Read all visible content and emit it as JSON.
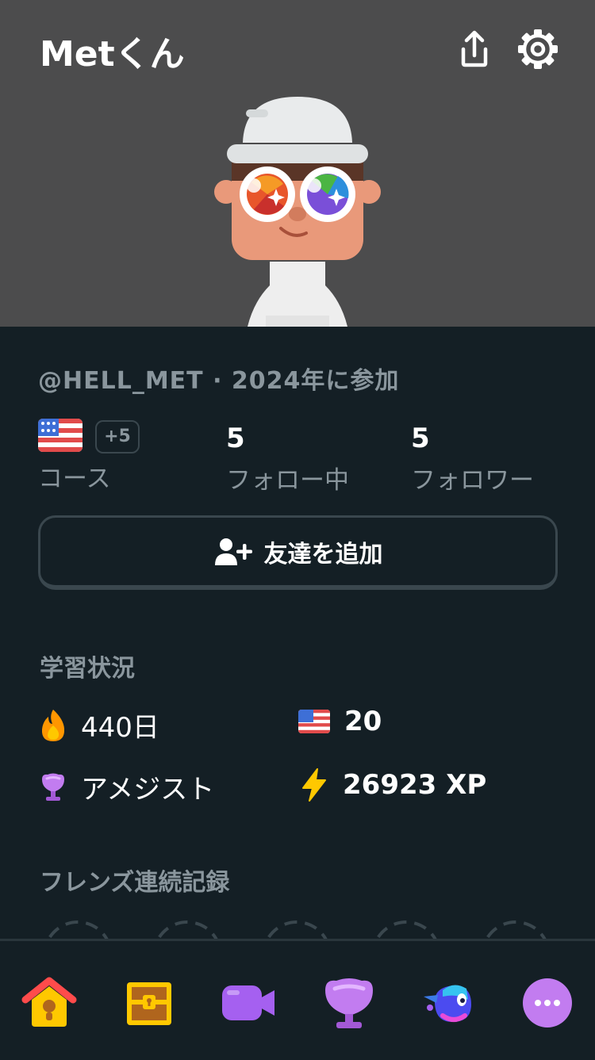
{
  "header": {
    "title": "Metくん",
    "background": "#4c4c4d"
  },
  "profile": {
    "handle_line": "@HELL_MET · 2024年に参加",
    "courses_more": "+5",
    "courses_label": "コース",
    "following_count": "5",
    "following_label": "フォロー中",
    "followers_count": "5",
    "followers_label": "フォロワー",
    "add_friend_label": "友達を追加"
  },
  "progress": {
    "section_title": "学習状況",
    "streak": "440日",
    "courses_count": "20",
    "league": "アメジスト",
    "xp": "26923 XP"
  },
  "friends": {
    "section_title": "フレンズ連続記録"
  },
  "nav": {
    "items": [
      "home-icon",
      "chest-icon",
      "video-icon",
      "league-icon",
      "bird-icon",
      "more-icon"
    ]
  },
  "colors": {
    "background": "#141f25",
    "muted_text": "#8a969d",
    "border": "#3a474e",
    "amethyst": "#c27cf0"
  }
}
